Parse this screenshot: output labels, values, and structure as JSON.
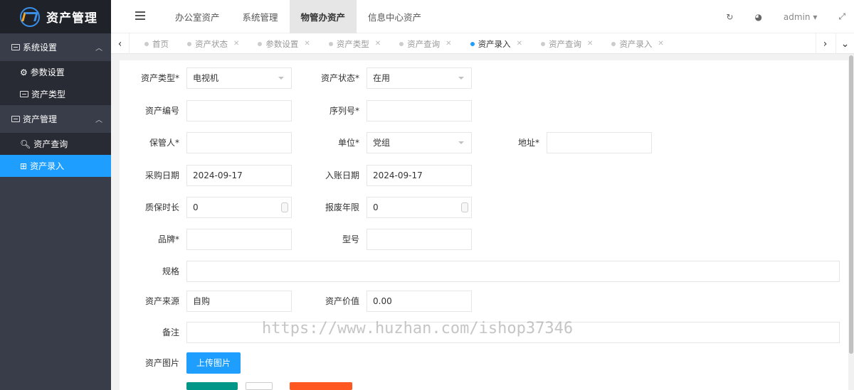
{
  "app": {
    "title": "资产管理"
  },
  "sidebar": {
    "groups": [
      {
        "label": "系统设置",
        "items": [
          {
            "label": "参数设置"
          },
          {
            "label": "资产类型"
          }
        ]
      },
      {
        "label": "资产管理",
        "items": [
          {
            "label": "资产查询"
          },
          {
            "label": "资产录入"
          }
        ]
      }
    ]
  },
  "topnav": {
    "tabs": [
      "办公室资产",
      "系统管理",
      "物管办资产",
      "信息中心资产"
    ],
    "active": "物管办资产",
    "user": "admin"
  },
  "pagetabs": {
    "items": [
      "首页",
      "资产状态",
      "参数设置",
      "资产类型",
      "资产查询",
      "资产录入",
      "资产查询",
      "资产录入"
    ],
    "active_index": 5
  },
  "form": {
    "asset_type": {
      "label": "资产类型*",
      "value": "电视机"
    },
    "asset_status": {
      "label": "资产状态*",
      "value": "在用"
    },
    "asset_no": {
      "label": "资产编号",
      "value": ""
    },
    "serial_no": {
      "label": "序列号*",
      "value": ""
    },
    "custodian": {
      "label": "保管人*",
      "value": ""
    },
    "unit": {
      "label": "单位*",
      "value": "党组"
    },
    "address": {
      "label": "地址*",
      "value": ""
    },
    "purchase_date": {
      "label": "采购日期",
      "value": "2024-09-17"
    },
    "entry_date": {
      "label": "入账日期",
      "value": "2024-09-17"
    },
    "warranty": {
      "label": "质保时长",
      "value": "0"
    },
    "scrap_years": {
      "label": "报废年限",
      "value": "0"
    },
    "brand": {
      "label": "品牌*",
      "value": ""
    },
    "model": {
      "label": "型号",
      "value": ""
    },
    "spec": {
      "label": "规格",
      "value": ""
    },
    "source": {
      "label": "资产来源",
      "value": "自购"
    },
    "price": {
      "label": "资产价值",
      "value": "0.00"
    },
    "remark": {
      "label": "备注",
      "value": ""
    },
    "image": {
      "label": "资产图片",
      "upload_label": "上传图片"
    }
  },
  "watermark": "https://www.huzhan.com/ishop37346",
  "colors": {
    "sidebar": "#393d49",
    "accent": "#1e9fff",
    "green": "#009688",
    "orange": "#ff5722"
  }
}
